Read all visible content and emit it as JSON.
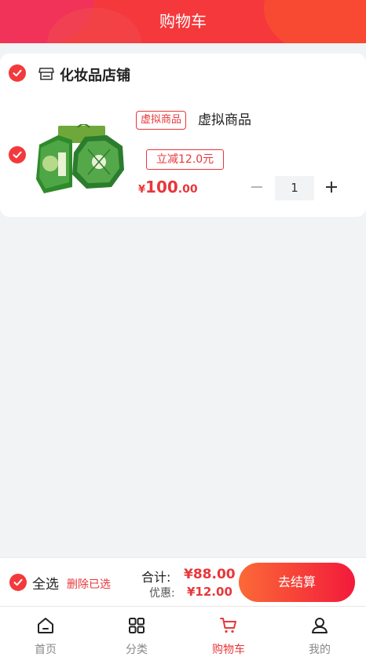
{
  "header": {
    "title": "购物车"
  },
  "shop": {
    "name": "化妆品店铺",
    "icon": "shop-icon",
    "checked": true
  },
  "item": {
    "checked": true,
    "tag": "虚拟商品",
    "name": "虚拟商品",
    "discount_label": "立减12.0元",
    "price_currency": "¥",
    "price_int": "100",
    "price_dec": ".00",
    "quantity": "1"
  },
  "bottom": {
    "select_all_label": "全选",
    "delete_label": "删除已选",
    "total_label": "合计:",
    "total_value": "¥88.00",
    "discount_label": "优惠:",
    "discount_value": "¥12.00",
    "checkout_label": "去结算"
  },
  "tabs": [
    {
      "label": "首页",
      "icon": "home-icon"
    },
    {
      "label": "分类",
      "icon": "category-grid-icon"
    },
    {
      "label": "购物车",
      "icon": "cart-icon",
      "active": true
    },
    {
      "label": "我的",
      "icon": "user-icon"
    }
  ],
  "colors": {
    "accent": "#e8373a",
    "header_bg": "#f5383b",
    "page_bg": "#f2f3f5"
  }
}
